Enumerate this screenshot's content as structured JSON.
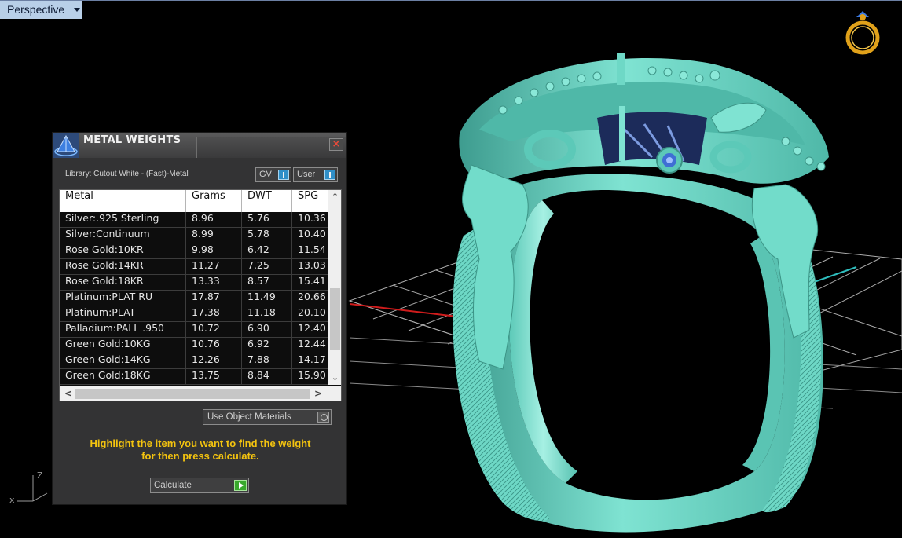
{
  "viewport": {
    "name": "Perspective",
    "axes": {
      "z": "Z",
      "x": "x"
    }
  },
  "dialog": {
    "title": "METAL WEIGHTS",
    "close": "×",
    "library": "Library: Cutout White - (Fast)-Metal",
    "gv_label": "GV",
    "user_label": "User",
    "columns": [
      "Metal",
      "Grams",
      "DWT",
      "SPG"
    ],
    "rows": [
      [
        "Silver:.925 Sterling",
        "8.96",
        "5.76",
        "10.36"
      ],
      [
        "Silver:Continuum",
        "8.99",
        "5.78",
        "10.40"
      ],
      [
        "Rose Gold:10KR",
        "9.98",
        "6.42",
        "11.54"
      ],
      [
        "Rose Gold:14KR",
        "11.27",
        "7.25",
        "13.03"
      ],
      [
        "Rose Gold:18KR",
        "13.33",
        "8.57",
        "15.41"
      ],
      [
        "Platinum:PLAT RU",
        "17.87",
        "11.49",
        "20.66"
      ],
      [
        "Platinum:PLAT",
        "17.38",
        "11.18",
        "20.10"
      ],
      [
        "Palladium:PALL .950",
        "10.72",
        "6.90",
        "12.40"
      ],
      [
        "Green Gold:10KG",
        "10.76",
        "6.92",
        "12.44"
      ],
      [
        "Green Gold:14KG",
        "12.26",
        "7.88",
        "14.17"
      ],
      [
        "Green Gold:18KG",
        "13.75",
        "8.84",
        "15.90"
      ]
    ],
    "use_object_materials": "Use Object Materials",
    "hint_line1": "Highlight the item you want to find the weight",
    "hint_line2": "for then press calculate.",
    "calculate": "Calculate"
  },
  "colors": {
    "ring": "#6ed8c6",
    "hint": "#f3c30f",
    "grid": "#ffffff",
    "x_axis": "#d01c1c",
    "y_axis": "#2fbfbf"
  }
}
